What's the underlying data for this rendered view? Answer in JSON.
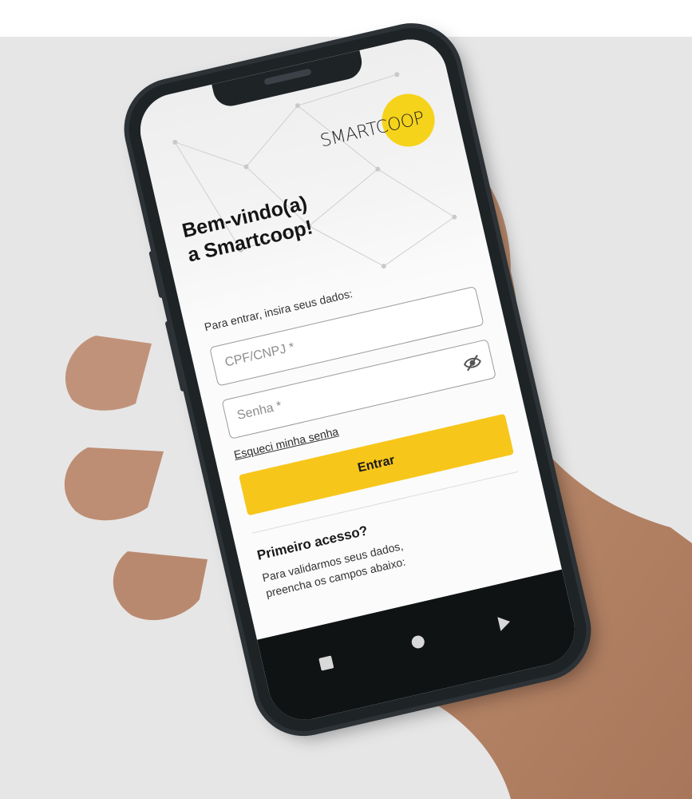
{
  "logo": {
    "text": "SMARTCOOP"
  },
  "welcome": {
    "line1": "Bem-vindo(a)",
    "line2": "a Smartcoop!"
  },
  "login": {
    "instructions": "Para entrar, insira seus dados:",
    "cpf_placeholder": "CPF/CNPJ *",
    "senha_placeholder": "Senha *",
    "forgot_link": "Esqueci minha senha",
    "submit_label": "Entrar"
  },
  "first_access": {
    "title": "Primeiro acesso?",
    "line1": "Para validarmos seus dados,",
    "line2": "preencha os campos abaixo:"
  },
  "icons": {
    "password_toggle": "eye-off-icon",
    "nav_recent": "square-icon",
    "nav_home": "circle-icon",
    "nav_back": "triangle-back-icon"
  },
  "colors": {
    "brand_yellow": "#f6d31b",
    "button_yellow": "#f7c61a",
    "backdrop": "#e6e6e6",
    "phone_frame": "#1e2326"
  }
}
